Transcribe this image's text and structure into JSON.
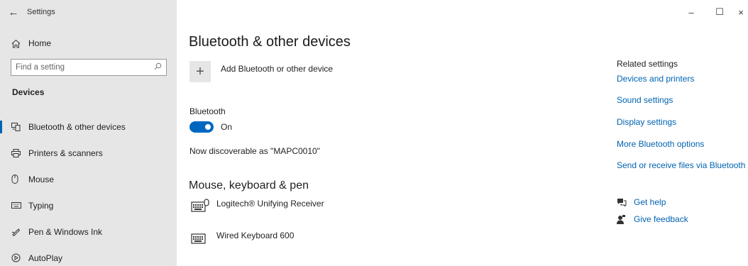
{
  "window": {
    "title": "Settings",
    "back_icon": "back-arrow-icon",
    "controls": {
      "minimize": "–",
      "maximize": "☐",
      "close": "×"
    }
  },
  "sidebar": {
    "home_label": "Home",
    "search_placeholder": "Find a setting",
    "section_title": "Devices",
    "items": [
      {
        "label": "Bluetooth & other devices",
        "icon": "bluetooth-devices-icon",
        "selected": true
      },
      {
        "label": "Printers & scanners",
        "icon": "printer-icon",
        "selected": false
      },
      {
        "label": "Mouse",
        "icon": "mouse-icon",
        "selected": false
      },
      {
        "label": "Typing",
        "icon": "keyboard-icon",
        "selected": false
      },
      {
        "label": "Pen & Windows Ink",
        "icon": "pen-icon",
        "selected": false
      },
      {
        "label": "AutoPlay",
        "icon": "autoplay-icon",
        "selected": false
      }
    ]
  },
  "main": {
    "title": "Bluetooth & other devices",
    "add_device_label": "Add Bluetooth or other device",
    "bluetooth_label": "Bluetooth",
    "bluetooth_state": "On",
    "discoverable_text": "Now discoverable as \"MAPC0010\"",
    "mkp_title": "Mouse, keyboard & pen",
    "devices": [
      {
        "label": "Logitech® Unifying Receiver",
        "icon": "keyboard-mouse-icon"
      },
      {
        "label": "Wired Keyboard 600",
        "icon": "keyboard-icon"
      }
    ]
  },
  "related": {
    "title": "Related settings",
    "links": [
      "Devices and printers",
      "Sound settings",
      "Display settings",
      "More Bluetooth options",
      "Send or receive files via Bluetooth"
    ],
    "get_help": "Get help",
    "give_feedback": "Give feedback"
  },
  "colors": {
    "accent": "#0063b1",
    "sidebar_bg": "#e6e6e6",
    "toggle_on": "#0067c0"
  }
}
